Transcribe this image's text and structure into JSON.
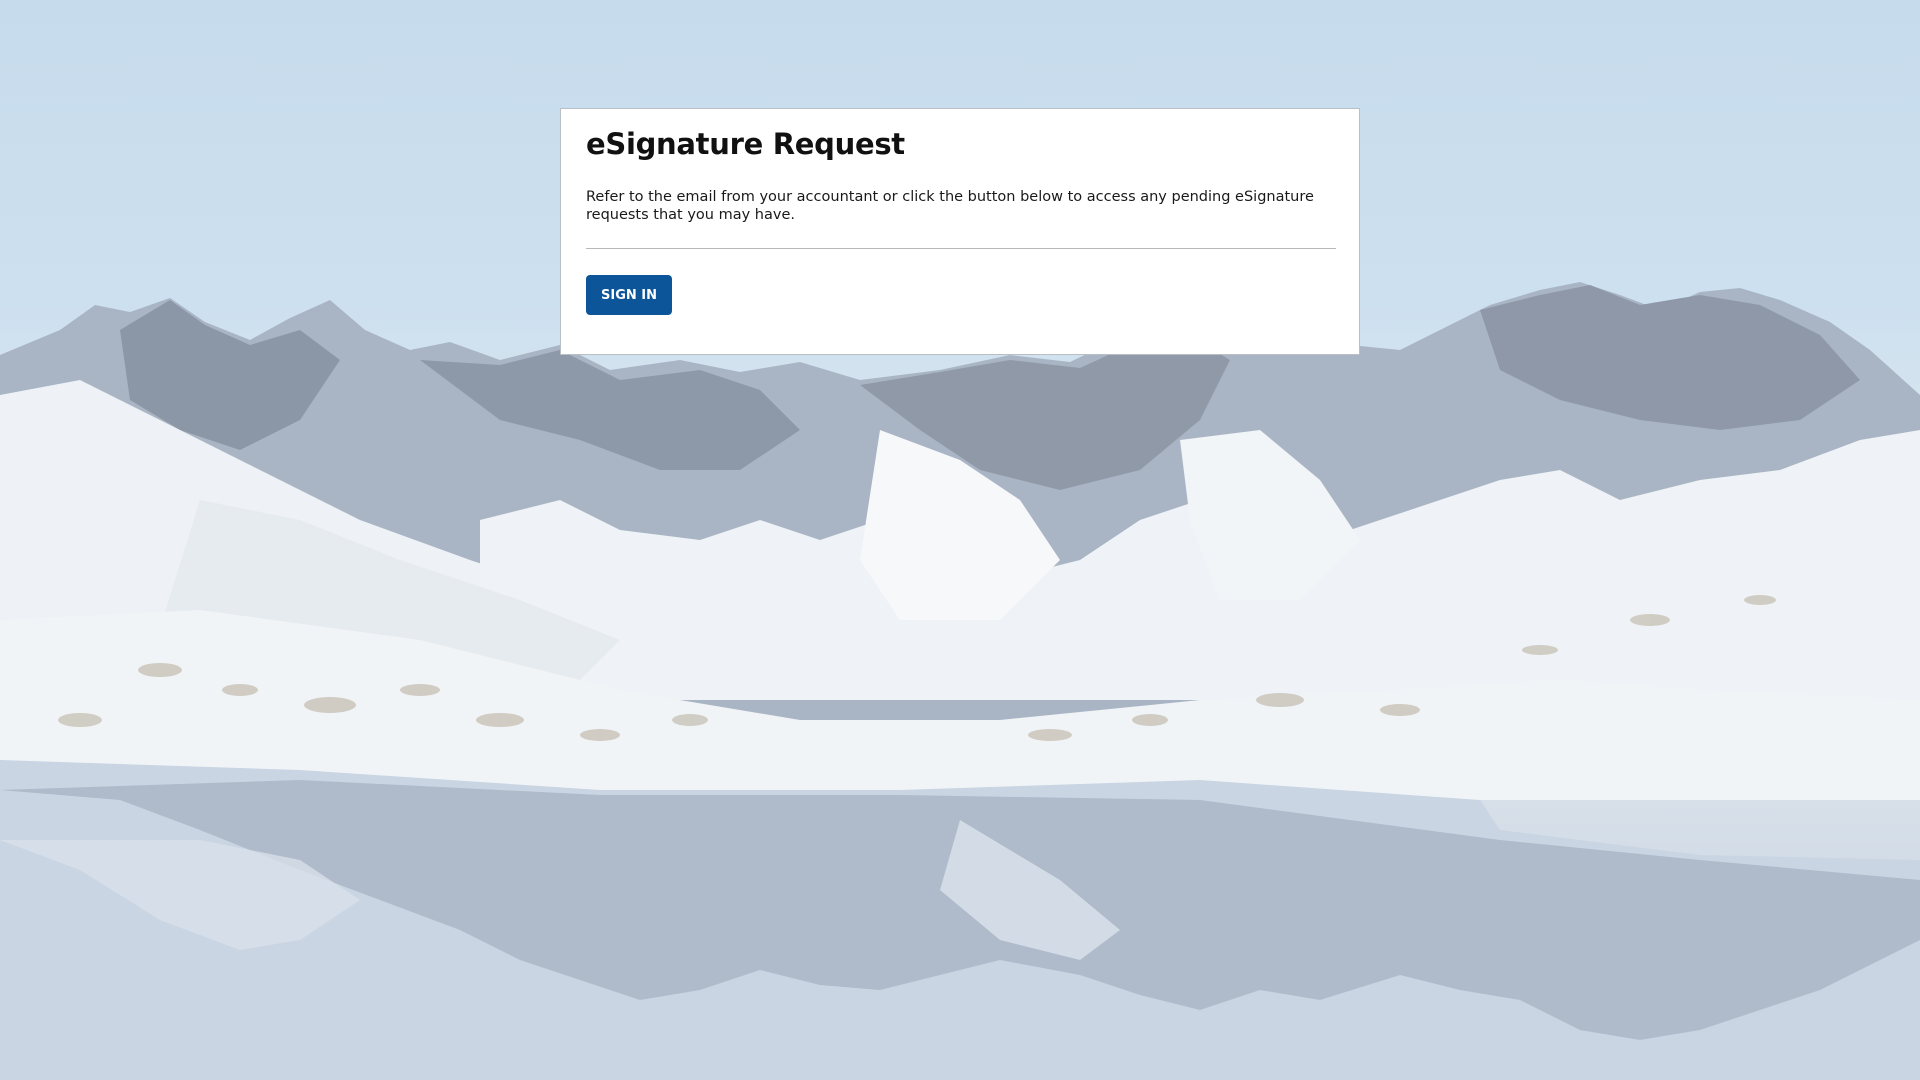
{
  "colors": {
    "card_background": "#ffffff",
    "button_background": "#0d5599",
    "button_text": "#ffffff",
    "title_text": "#111111"
  },
  "background": {
    "image": "snowy mountain lake landscape with reflection"
  },
  "card": {
    "title": "eSignature Request",
    "description": "Refer to the email from your accountant or click the button below to access any pending eSignature requests that you may have.",
    "sign_in_label": "SIGN IN"
  }
}
